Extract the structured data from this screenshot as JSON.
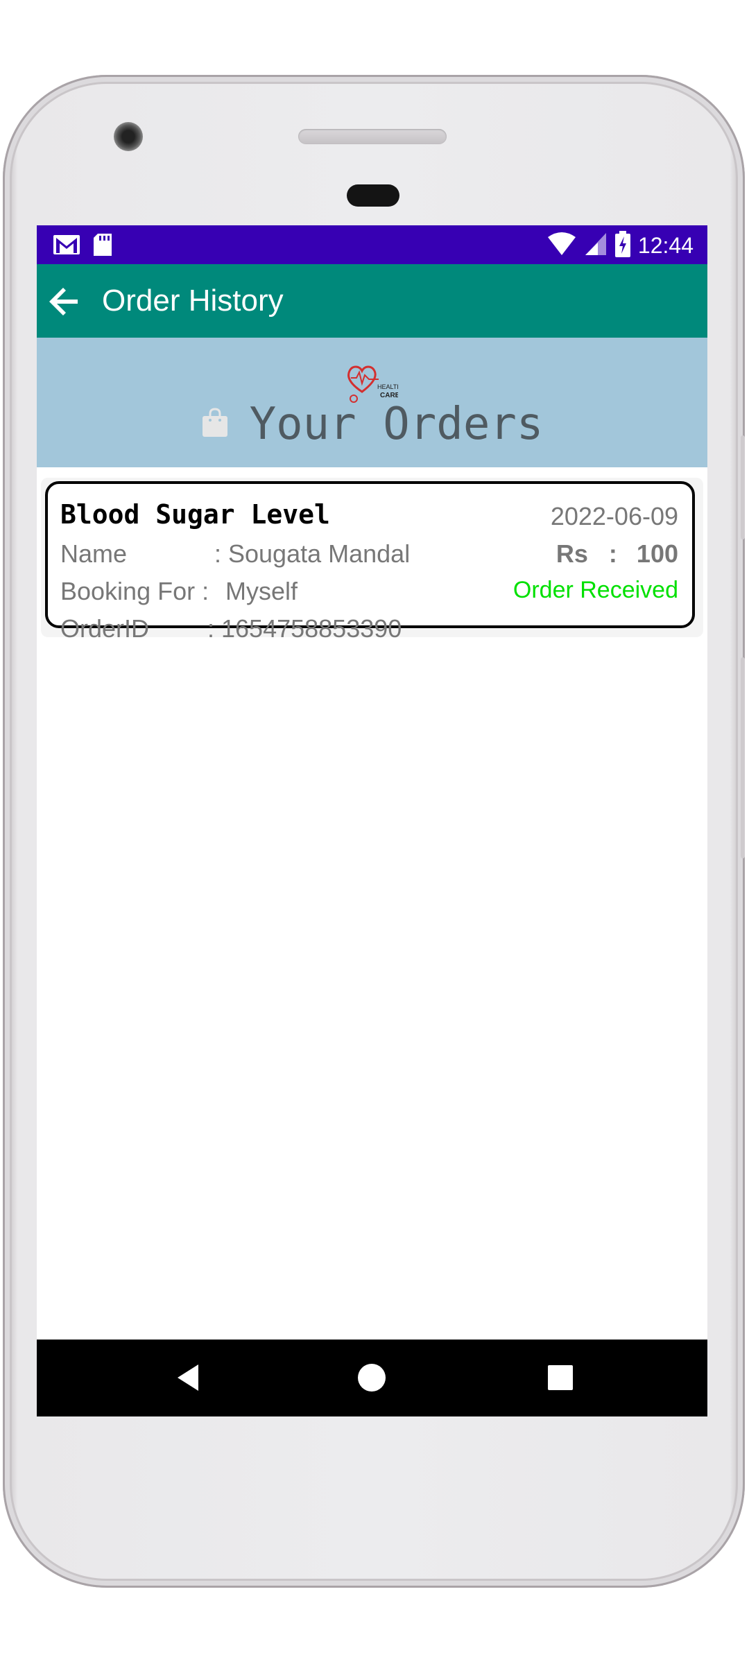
{
  "status_bar": {
    "time": "12:44",
    "left_icons": [
      "gmail-icon",
      "sd-card-icon"
    ],
    "right_icons": [
      "wifi-icon",
      "signal-icon",
      "battery-charging-icon"
    ]
  },
  "toolbar": {
    "title": "Order History",
    "back_icon": "arrow-back-icon"
  },
  "header": {
    "logo_text_1": "HEALTH",
    "logo_text_2": "CARE",
    "title": "Your Orders",
    "bag_icon": "shopping-bag-icon"
  },
  "orders": [
    {
      "test_name": "Blood Sugar Level",
      "date": "2022-06-09",
      "name_label": "Name",
      "name_value": ": Sougata Mandal",
      "booking_label": "Booking For :",
      "booking_value": "Myself",
      "orderid_label": "OrderID",
      "orderid_value": ": 1654758853390",
      "price_label": "Rs   :",
      "price_value": "100",
      "status": "Order Received"
    }
  ],
  "colors": {
    "status_bar": "#3700b3",
    "toolbar": "#00897b",
    "header_band": "#a2c6da",
    "status_text": "#00e000"
  },
  "nav": {
    "back": "nav-back-icon",
    "home": "nav-home-icon",
    "recents": "nav-recents-icon"
  }
}
